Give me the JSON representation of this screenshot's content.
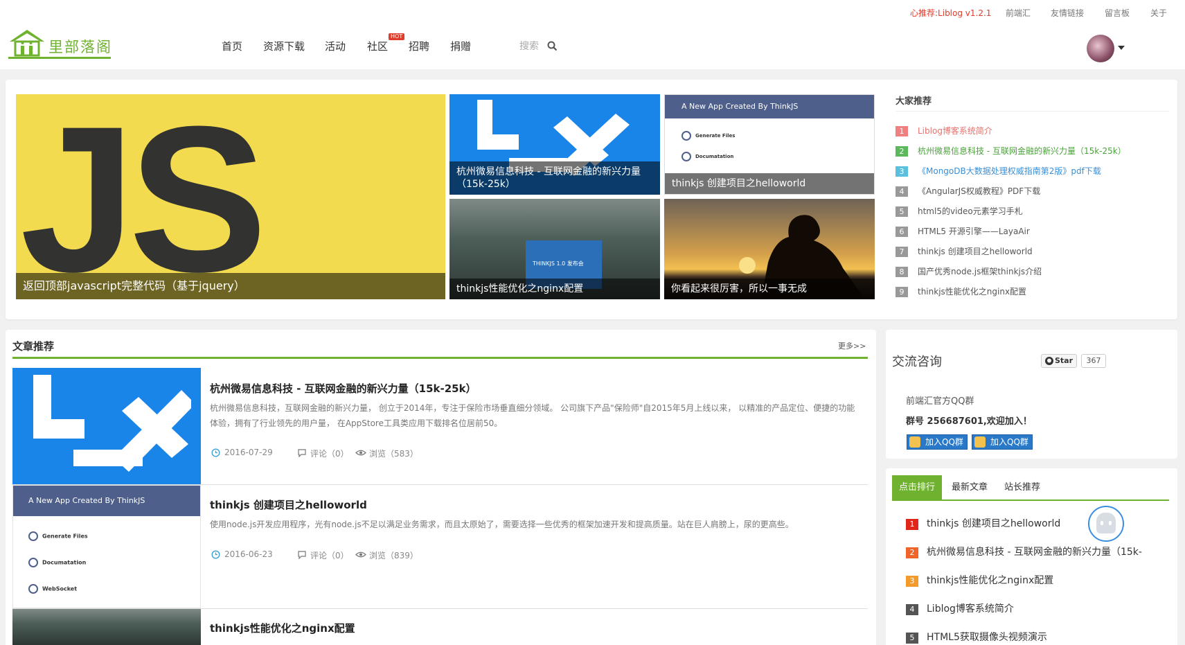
{
  "topbar": {
    "links": [
      {
        "label": "心推荐:Liblog v1.2.1",
        "color": "#e03c2c"
      },
      {
        "label": "前端汇",
        "color": "#777777"
      },
      {
        "label": "友情链接",
        "color": "#777777"
      },
      {
        "label": "留言板",
        "color": "#777777"
      },
      {
        "label": "关于",
        "color": "#777777"
      }
    ],
    "logo_text": "里部落阁",
    "nav": [
      "首页",
      "资源下载",
      "活动",
      "社区",
      "招聘",
      "捐赠"
    ],
    "hot_badge": "HOT",
    "search_label": "搜索"
  },
  "slider": {
    "tiles": [
      {
        "caption": "返回顶部javascript完整代码（基于jquery）",
        "art": "JS"
      },
      {
        "caption": "杭州微易信息科技 - 互联网金融的新兴力量（15k-25k）"
      },
      {
        "caption": "thinkjs 创建项目之helloworld",
        "header": "A New App Created By ThinkJS"
      },
      {
        "caption": "thinkjs性能优化之nginx配置",
        "screen_text": "THINKJS 1.0 发布会"
      },
      {
        "caption": "你看起来很厉害，所以一事无成"
      }
    ],
    "think_lines": [
      "Generate Files",
      "Documatation",
      "WebSocket"
    ]
  },
  "recommend": {
    "title": "大家推荐",
    "items": [
      {
        "num": "1",
        "label": "Liblog博客系统简介",
        "color": "#f08080",
        "text_color": "#e8716b"
      },
      {
        "num": "2",
        "label": "杭州微易信息科技 - 互联网金融的新兴力量（15k-25k）",
        "color": "#5cb85c",
        "text_color": "#4aa23a"
      },
      {
        "num": "3",
        "label": "《MongoDB大数据处理权威指南第2版》pdf下载",
        "color": "#5bc0de",
        "text_color": "#3a8fd6"
      },
      {
        "num": "4",
        "label": "《AngularJS权威教程》PDF下载",
        "color": "#999999",
        "text_color": "#555555"
      },
      {
        "num": "5",
        "label": "html5的video元素学习手札",
        "color": "#999999",
        "text_color": "#555555"
      },
      {
        "num": "6",
        "label": "HTML5 开源引擎——LayaAir",
        "color": "#999999",
        "text_color": "#555555"
      },
      {
        "num": "7",
        "label": "thinkjs 创建项目之helloworld",
        "color": "#999999",
        "text_color": "#555555"
      },
      {
        "num": "8",
        "label": "国产优秀node.js框架thinkjs介绍",
        "color": "#999999",
        "text_color": "#555555"
      },
      {
        "num": "9",
        "label": "thinkjs性能优化之nginx配置",
        "color": "#999999",
        "text_color": "#555555"
      }
    ]
  },
  "articles": {
    "title": "文章推荐",
    "more": "更多>>",
    "items": [
      {
        "title": "杭州微易信息科技 - 互联网金融的新兴力量（15k-25k）",
        "desc": "杭州微易信息科技，互联网金融的新兴力量， 创立于2014年，专注于保险市场垂直细分领域。 公司旗下产品\"保险师\"自2015年5月上线以来， 以精准的产品定位、便捷的功能体验，拥有了行业领先的用户量， 在AppStore工具类应用下载排名位居前50。",
        "date": "2016-07-29",
        "comments": "评论（0）",
        "views": "浏览（583）"
      },
      {
        "title": "thinkjs 创建项目之helloworld",
        "desc": "使用node.js开发应用程序，光有node.js不足以满足业务需求，而且太原始了，需要选择一些优秀的框架加速开发和提高质量。站在巨人肩膀上，尿的更高些。",
        "date": "2016-06-23",
        "comments": "评论（0）",
        "views": "浏览（839）",
        "thumb_header": "A New App Created By ThinkJS"
      },
      {
        "title": "thinkjs性能优化之nginx配置"
      }
    ]
  },
  "qq": {
    "title": "交流咨询",
    "star_label": "Star",
    "star_count": "367",
    "group_name": "前端汇官方QQ群",
    "group_number": "群号 256687601,欢迎加入！",
    "join_label": "加入QQ群"
  },
  "ranking": {
    "tabs": [
      "点击排行",
      "最新文章",
      "站长推荐"
    ],
    "items": [
      {
        "num": "1",
        "label": "thinkjs 创建项目之helloworld",
        "color": "#e0261a"
      },
      {
        "num": "2",
        "label": "杭州微易信息科技 - 互联网金融的新兴力量（15k-",
        "color": "#f0642a"
      },
      {
        "num": "3",
        "label": "thinkjs性能优化之nginx配置",
        "color": "#f49a2a"
      },
      {
        "num": "4",
        "label": "Liblog博客系统简介",
        "color": "#555555"
      },
      {
        "num": "5",
        "label": "HTML5获取摄像头视频演示",
        "color": "#555555"
      }
    ]
  },
  "colors": {
    "brand_green": "#6fb230",
    "accent_red": "#e03c2c",
    "link_blue": "#2a78c8"
  }
}
